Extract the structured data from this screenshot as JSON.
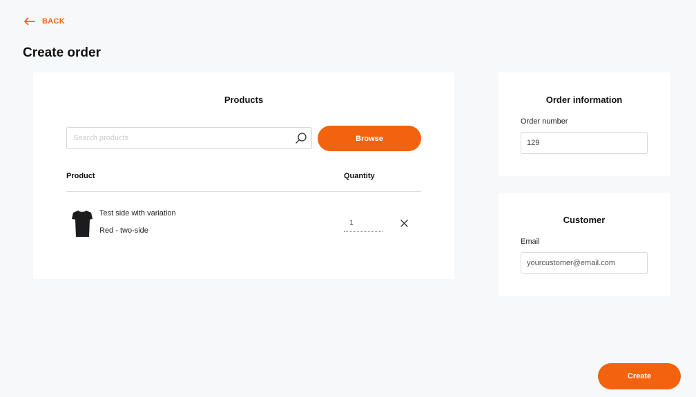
{
  "nav": {
    "back_label": "BACK"
  },
  "page": {
    "title": "Create order"
  },
  "products": {
    "title": "Products",
    "search_placeholder": "Search products",
    "browse_label": "Browse",
    "columns": {
      "product": "Product",
      "quantity": "Quantity"
    },
    "items": [
      {
        "name": "Test side with variation",
        "variant": "Red - two-side",
        "quantity": "1"
      }
    ]
  },
  "order_info": {
    "title": "Order information",
    "order_number_label": "Order number",
    "order_number_value": "129"
  },
  "customer": {
    "title": "Customer",
    "email_label": "Email",
    "email_placeholder": "yourcustomer@email.com"
  },
  "actions": {
    "create_label": "Create"
  },
  "icons": {
    "back": "arrow-left-icon",
    "search": "search-icon",
    "remove": "close-icon",
    "product": "tshirt-icon"
  },
  "colors": {
    "accent": "#f3620f",
    "background": "#f7f8fa",
    "card": "#ffffff"
  }
}
